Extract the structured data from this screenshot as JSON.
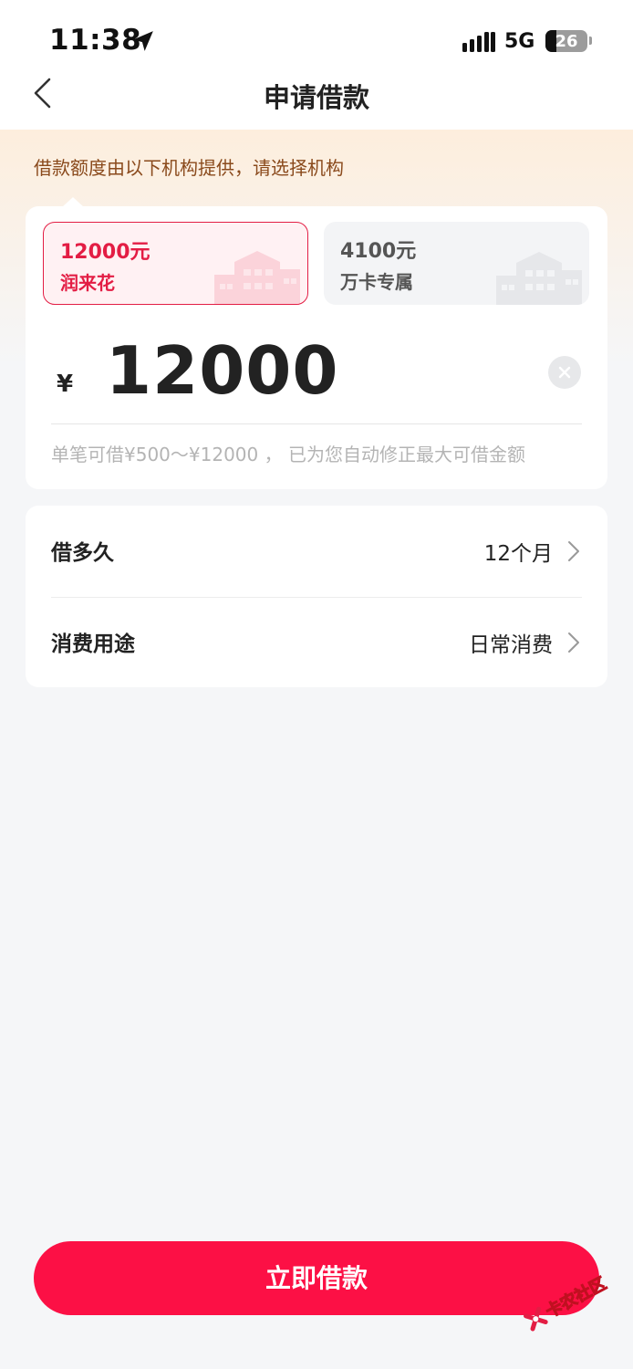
{
  "status_bar": {
    "time": "11:38",
    "network": "5G",
    "battery_level": "26",
    "icons": [
      "location-arrow-icon",
      "signal-bars-icon",
      "battery-icon"
    ]
  },
  "nav": {
    "title": "申请借款",
    "back_icon": "chevron-left-icon"
  },
  "notice": "借款额度由以下机构提供，请选择机构",
  "institutions": [
    {
      "amount": "12000元",
      "name": "润来花",
      "selected": true
    },
    {
      "amount": "4100元",
      "name": "万卡专属",
      "selected": false
    }
  ],
  "loan": {
    "currency_symbol": "¥",
    "amount": "12000",
    "hint": "单笔可借¥500～¥12000 ， 已为您自动修正最大可借金额"
  },
  "options": [
    {
      "label": "借多久",
      "value": "12个月"
    },
    {
      "label": "消费用途",
      "value": "日常消费"
    }
  ],
  "submit_label": "立即借款",
  "watermark": "卡农社区",
  "colors": {
    "accent": "#fc1045",
    "selected_border": "#e31d44",
    "notice_text": "#8a4a1c",
    "background": "#f5f6f8"
  }
}
